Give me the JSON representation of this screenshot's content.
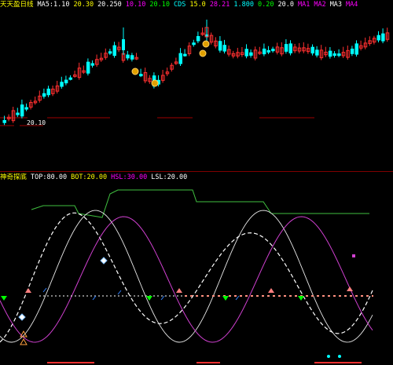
{
  "main_header": {
    "title": "天天盈日线",
    "indicators": [
      {
        "text": "MA5:1.10",
        "color": "#ffffff"
      },
      {
        "text": "20.30",
        "color": "#ffff00"
      },
      {
        "text": "20.250",
        "color": "#ffffff"
      },
      {
        "text": "10.10",
        "color": "#ff00ff"
      },
      {
        "text": "20.10",
        "color": "#00ff00"
      },
      {
        "text": "CDS",
        "color": "#00ffff"
      },
      {
        "text": "15.0",
        "color": "#ffff00"
      },
      {
        "text": "28.21",
        "color": "#ff00ff"
      },
      {
        "text": "1.800",
        "color": "#00ffff"
      },
      {
        "text": "0.20",
        "color": "#00ff00"
      },
      {
        "text": "20.0",
        "color": "#ffffff"
      },
      {
        "text": "MA1",
        "color": "#ff00ff"
      },
      {
        "text": "MA2",
        "color": "#ff00ff"
      },
      {
        "text": "MA3",
        "color": "#ffffff"
      },
      {
        "text": "MA4",
        "color": "#ff00ff"
      }
    ]
  },
  "sub_header": {
    "title": "神奇探底",
    "indicators": [
      {
        "text": "TOP:80.00",
        "color": "#ffffff"
      },
      {
        "text": "BOT:20.00",
        "color": "#ffff00"
      },
      {
        "text": "HSL:30.00",
        "color": "#ff00ff"
      },
      {
        "text": "LSL:20.00",
        "color": "#ffffff"
      }
    ]
  },
  "price_label": "20.10",
  "colors": {
    "up": "#ff3030",
    "down": "#00ffff",
    "level": "#a00000",
    "osc_white": "#ffffff",
    "osc_magenta": "#d040d0",
    "osc_green": "#40c040",
    "signal_dots": "#ff9080"
  },
  "icons": [
    "coin-icon",
    "down-arrow-icon",
    "up-arrow-icon",
    "diamond-icon",
    "warning-triangle-icon"
  ]
}
